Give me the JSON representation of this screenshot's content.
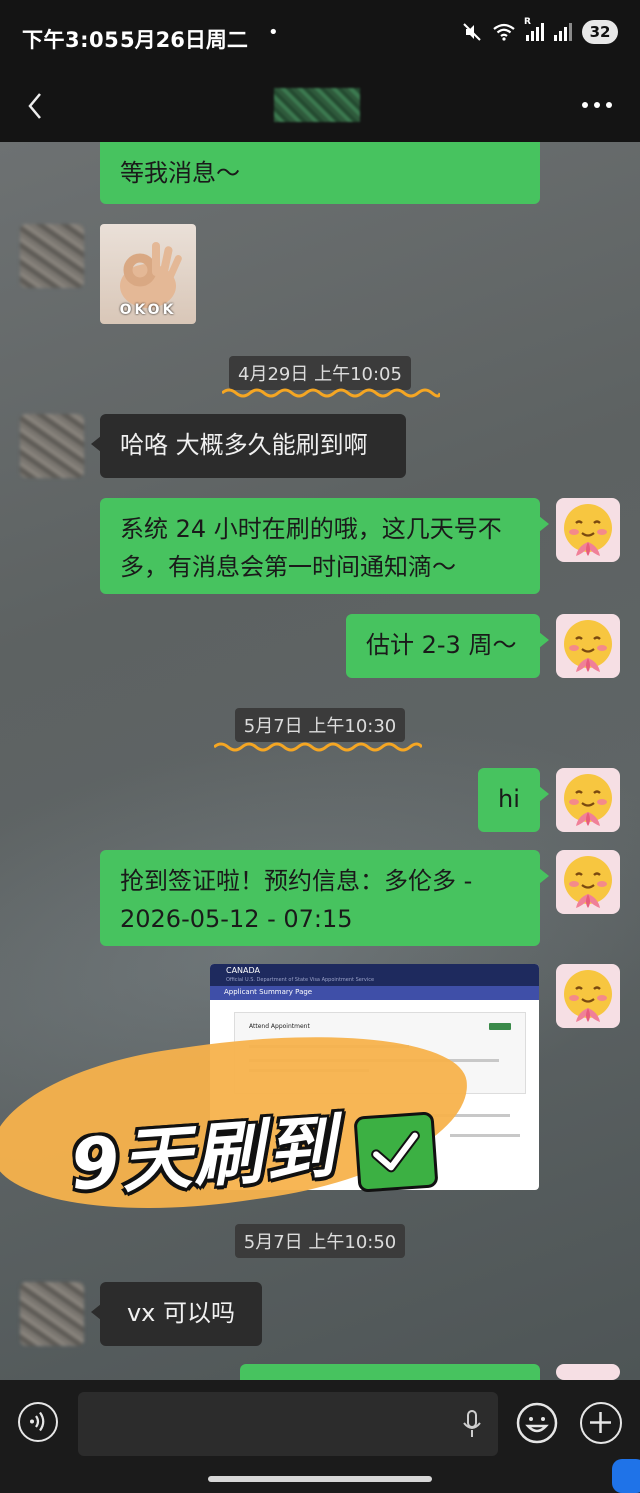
{
  "status_bar": {
    "time": "下午3:05",
    "date": "5月26日周二",
    "dot": "•",
    "network_label": "R",
    "battery": "32",
    "icons": [
      "mute-icon",
      "wifi-icon",
      "signal-icon",
      "battery-icon"
    ]
  },
  "nav": {
    "back_icon": "chevron-left-icon",
    "more_icon": "more-dots-icon"
  },
  "messages": {
    "m1": "等我消息〜",
    "sticker_caption": "OKOK",
    "ts1": "4月29日 上午10:05",
    "m2": "哈咯 大概多久能刷到啊",
    "m3": "系统 24 小时在刷的哦，这几天号不多，有消息会第一时间通知滴〜",
    "m4": "估计 2-3 周〜",
    "ts2": "5月7日 上午10:30",
    "m5": "hi",
    "m6": "抢到签证啦！预约信息：多伦多 - 2026-05-12 - 07:15",
    "screenshot": {
      "brand": "CANADA",
      "subtitle": "Official U.S. Department of State Visa Appointment Service",
      "page_title": "Applicant Summary Page",
      "card_title": "Attend Appointment"
    },
    "overlay": "9天刷到",
    "ts3": "5月7日 上午10:50",
    "m7": "vx 可以吗"
  },
  "colors": {
    "green_bubble": "#47c35f",
    "dark_bubble": "#2c2c2c",
    "squiggle": "#f5a623",
    "overlay": "#f7b24c"
  }
}
